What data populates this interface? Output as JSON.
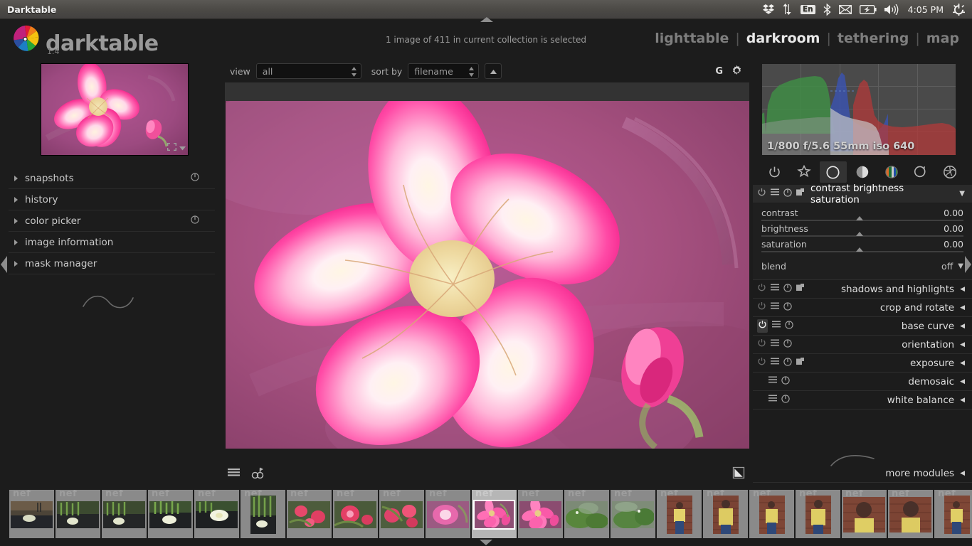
{
  "os": {
    "window_title": "Darktable",
    "tray": [
      {
        "name": "dropbox-icon",
        "glyph": "dropbox"
      },
      {
        "name": "network-transfer-icon",
        "glyph": "arrows"
      },
      {
        "name": "keyboard-layout-icon",
        "label": "En"
      },
      {
        "name": "bluetooth-icon",
        "glyph": "bluetooth"
      },
      {
        "name": "mail-icon",
        "glyph": "envelope"
      },
      {
        "name": "battery-icon",
        "glyph": "battery"
      },
      {
        "name": "volume-icon",
        "glyph": "speaker"
      }
    ],
    "clock": "4:05 PM",
    "session_icon": "power-gear-icon"
  },
  "app": {
    "name": "darktable",
    "version": "1.4",
    "collection_status": "1 image of 411 in current collection is selected",
    "views": [
      {
        "label": "lighttable",
        "active": false
      },
      {
        "label": "darkroom",
        "active": true
      },
      {
        "label": "tethering",
        "active": false
      },
      {
        "label": "map",
        "active": false
      }
    ],
    "view_separator": "|"
  },
  "toolbar": {
    "view_label": "view",
    "view_value": "all",
    "sort_label": "sort by",
    "sort_value": "filename",
    "sort_direction_icon": "sort-ascending-icon",
    "grouping_badge": "G",
    "preferences_icon": "gear-icon"
  },
  "left_panel": {
    "navigation": {
      "fit_icon": "zoom-fit-icon",
      "dropdown_icon": "chevron-down-icon"
    },
    "items": [
      {
        "label": "snapshots",
        "reset": true
      },
      {
        "label": "history",
        "reset": false
      },
      {
        "label": "color picker",
        "reset": true
      },
      {
        "label": "image information",
        "reset": false
      },
      {
        "label": "mask manager",
        "reset": false
      }
    ]
  },
  "right_panel": {
    "histogram": {
      "exif": "1/800 f/5.6 55mm iso 640"
    },
    "module_groups": [
      {
        "name": "active-modules-icon",
        "glyph": "power",
        "active": false
      },
      {
        "name": "favorite-modules-icon",
        "glyph": "star",
        "active": false
      },
      {
        "name": "basic-modules-icon",
        "glyph": "circle",
        "active": true
      },
      {
        "name": "tone-modules-icon",
        "glyph": "half-circle",
        "active": false
      },
      {
        "name": "color-modules-icon",
        "glyph": "color-circle",
        "active": false
      },
      {
        "name": "correction-modules-icon",
        "glyph": "spiral",
        "active": false
      },
      {
        "name": "effect-modules-icon",
        "glyph": "globe",
        "active": false
      }
    ],
    "expanded_module": {
      "title": "contrast brightness saturation",
      "power": true,
      "multi_instance": true,
      "reset": true,
      "presets": true,
      "arrow": "▼",
      "sliders": [
        {
          "name": "contrast",
          "value": "0.00",
          "pos": 47
        },
        {
          "name": "brightness",
          "value": "0.00",
          "pos": 47
        },
        {
          "name": "saturation",
          "value": "0.00",
          "pos": 47
        }
      ],
      "blend_label": "blend",
      "blend_value": "off",
      "blend_arrow": "▼"
    },
    "modules": [
      {
        "title": "shadows and highlights",
        "power": true,
        "power_on": false,
        "presets": true,
        "arrow": "◀"
      },
      {
        "title": "crop and rotate",
        "power": true,
        "power_on": false,
        "presets": false,
        "arrow": "◀"
      },
      {
        "title": "base curve",
        "power": true,
        "power_on": true,
        "presets": false,
        "arrow": "◀"
      },
      {
        "title": "orientation",
        "power": true,
        "power_on": false,
        "presets": false,
        "arrow": "◀"
      },
      {
        "title": "exposure",
        "power": true,
        "power_on": false,
        "presets": true,
        "arrow": "◀"
      },
      {
        "title": "demosaic",
        "power": false,
        "power_on": false,
        "presets": false,
        "arrow": "◀"
      },
      {
        "title": "white balance",
        "power": false,
        "power_on": false,
        "presets": false,
        "arrow": "◀"
      }
    ],
    "more_modules": {
      "label": "more modules",
      "arrow": "◀"
    }
  },
  "bottom_toolbar": {
    "list_icon": "filmstrip-list-icon",
    "grouping_icon": "image-grouping-icon",
    "profile_icon": "display-profile-icon"
  },
  "filmstrip": {
    "extension_label": "nef",
    "thumbnails": [
      {
        "kind": "pond-lily-wide",
        "selected": false
      },
      {
        "kind": "grass-lily",
        "selected": false
      },
      {
        "kind": "grass-lily",
        "selected": false
      },
      {
        "kind": "grass-lily-big",
        "selected": false
      },
      {
        "kind": "lily-bloom",
        "selected": false
      },
      {
        "kind": "grass-lily-portrait",
        "selected": false
      },
      {
        "kind": "pink-roses",
        "selected": false
      },
      {
        "kind": "pink-roses",
        "selected": false
      },
      {
        "kind": "pink-roses",
        "selected": false
      },
      {
        "kind": "pink-flower-blur",
        "selected": false
      },
      {
        "kind": "desert-rose",
        "selected": true
      },
      {
        "kind": "desert-rose",
        "selected": false
      },
      {
        "kind": "green-foliage",
        "selected": false
      },
      {
        "kind": "green-foliage",
        "selected": false
      },
      {
        "kind": "man-wall-portrait",
        "selected": false
      },
      {
        "kind": "man-wall-portrait",
        "selected": false
      },
      {
        "kind": "man-wall-portrait",
        "selected": false
      },
      {
        "kind": "man-wall-portrait",
        "selected": false
      },
      {
        "kind": "man-wall-closeup",
        "selected": false
      },
      {
        "kind": "man-wall-closeup",
        "selected": false
      },
      {
        "kind": "man-wall-portrait",
        "selected": false
      }
    ]
  },
  "colors": {
    "background": "#1c1c1c",
    "panel_header": "#2a2a2a",
    "accent_text": "#ffffff",
    "titlebar": "#4c4a46",
    "filmstrip_cell": "#8a8a8a",
    "filmstrip_cell_selected": "#b6b6b6"
  }
}
